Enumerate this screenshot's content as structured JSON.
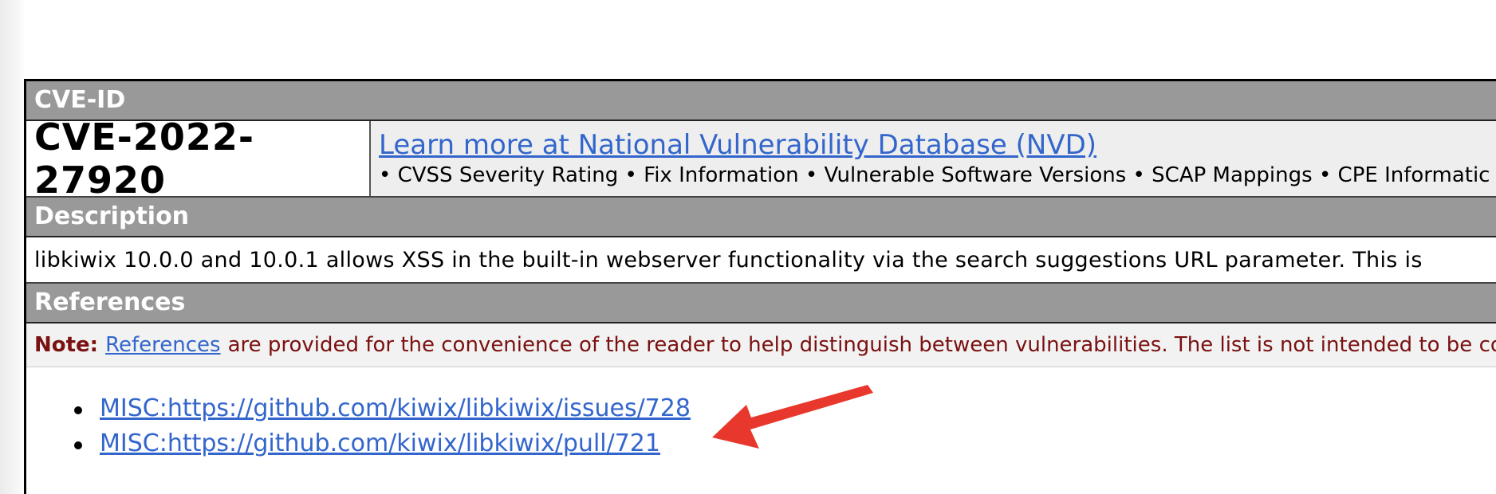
{
  "cve_id_section": {
    "header": "CVE-ID",
    "cve_id": "CVE-2022-27920",
    "nvd_link": "Learn more at National Vulnerability Database (NVD)",
    "nvd_features": "• CVSS Severity Rating • Fix Information • Vulnerable Software Versions • SCAP Mappings • CPE Informatic"
  },
  "description_section": {
    "header": "Description",
    "text": "libkiwix 10.0.0 and 10.0.1 allows XSS in the built-in webserver functionality via the search suggestions URL parameter. This is"
  },
  "references_section": {
    "header": "References",
    "note_label": "Note:",
    "note_link": "References",
    "note_text": "are provided for the convenience of the reader to help distinguish between vulnerabilities. The list is not intended to be com",
    "items": [
      {
        "label": "MISC:https://github.com/kiwix/libkiwix/issues/728"
      },
      {
        "label": "MISC:https://github.com/kiwix/libkiwix/pull/721"
      }
    ]
  },
  "colors": {
    "header_bg": "#999999",
    "link": "#3366cc",
    "note_text": "#7a1010",
    "annotation_arrow": "#e8382d"
  },
  "icons": {
    "annotation": "red-arrow-icon"
  }
}
